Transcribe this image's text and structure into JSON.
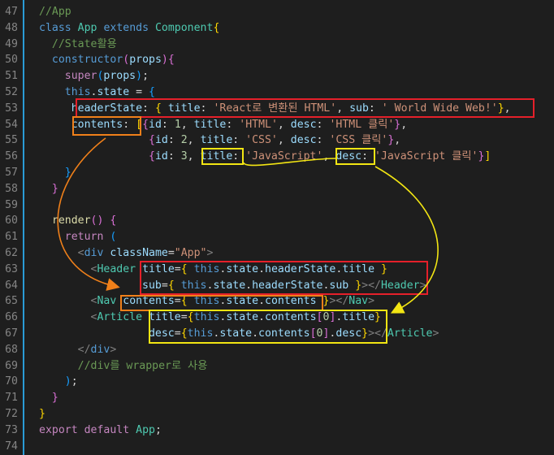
{
  "editor": {
    "lines": [
      {
        "num": "47",
        "tokens": [
          {
            "t": "//App",
            "c": "comment"
          }
        ]
      },
      {
        "num": "48",
        "tokens": [
          {
            "t": "class",
            "c": "kw"
          },
          {
            "t": " ",
            "c": "ident"
          },
          {
            "t": "App",
            "c": "cls"
          },
          {
            "t": " ",
            "c": "ident"
          },
          {
            "t": "extends",
            "c": "kw"
          },
          {
            "t": " ",
            "c": "ident"
          },
          {
            "t": "Component",
            "c": "cls"
          },
          {
            "t": "{",
            "c": "br1"
          }
        ]
      },
      {
        "num": "49",
        "tokens": [
          {
            "t": "  ",
            "c": "ident"
          },
          {
            "t": "//State활용",
            "c": "comment"
          }
        ]
      },
      {
        "num": "50",
        "tokens": [
          {
            "t": "  ",
            "c": "ident"
          },
          {
            "t": "constructor",
            "c": "kw"
          },
          {
            "t": "(",
            "c": "br2"
          },
          {
            "t": "props",
            "c": "var"
          },
          {
            "t": ")",
            "c": "br2"
          },
          {
            "t": "{",
            "c": "br2"
          }
        ]
      },
      {
        "num": "51",
        "tokens": [
          {
            "t": "    ",
            "c": "ident"
          },
          {
            "t": "super",
            "c": "ctrl"
          },
          {
            "t": "(",
            "c": "br3"
          },
          {
            "t": "props",
            "c": "var"
          },
          {
            "t": ")",
            "c": "br3"
          },
          {
            "t": ";",
            "c": "punc"
          }
        ]
      },
      {
        "num": "52",
        "tokens": [
          {
            "t": "    ",
            "c": "ident"
          },
          {
            "t": "this",
            "c": "kw"
          },
          {
            "t": ".",
            "c": "punc"
          },
          {
            "t": "state",
            "c": "var"
          },
          {
            "t": " = ",
            "c": "punc"
          },
          {
            "t": "{",
            "c": "br3"
          }
        ]
      },
      {
        "num": "53",
        "tokens": [
          {
            "t": "     ",
            "c": "ident"
          },
          {
            "t": "headerState",
            "c": "var"
          },
          {
            "t": ": ",
            "c": "punc"
          },
          {
            "t": "{",
            "c": "br1"
          },
          {
            "t": " ",
            "c": "ident"
          },
          {
            "t": "title",
            "c": "var"
          },
          {
            "t": ": ",
            "c": "punc"
          },
          {
            "t": "'React로 변환된 HTML'",
            "c": "str"
          },
          {
            "t": ", ",
            "c": "punc"
          },
          {
            "t": "sub",
            "c": "var"
          },
          {
            "t": ": ",
            "c": "punc"
          },
          {
            "t": "' World Wide Web!'",
            "c": "str"
          },
          {
            "t": "}",
            "c": "br1"
          },
          {
            "t": ",",
            "c": "punc"
          }
        ]
      },
      {
        "num": "54",
        "tokens": [
          {
            "t": "     ",
            "c": "ident"
          },
          {
            "t": "contents",
            "c": "var"
          },
          {
            "t": ": ",
            "c": "punc"
          },
          {
            "t": "[",
            "c": "br1"
          },
          {
            "t": "{",
            "c": "br2"
          },
          {
            "t": "id",
            "c": "var"
          },
          {
            "t": ": ",
            "c": "punc"
          },
          {
            "t": "1",
            "c": "num"
          },
          {
            "t": ", ",
            "c": "punc"
          },
          {
            "t": "title",
            "c": "var"
          },
          {
            "t": ": ",
            "c": "punc"
          },
          {
            "t": "'HTML'",
            "c": "str"
          },
          {
            "t": ", ",
            "c": "punc"
          },
          {
            "t": "desc",
            "c": "var"
          },
          {
            "t": ": ",
            "c": "punc"
          },
          {
            "t": "'HTML 클릭'",
            "c": "str"
          },
          {
            "t": "}",
            "c": "br2"
          },
          {
            "t": ",",
            "c": "punc"
          }
        ]
      },
      {
        "num": "55",
        "tokens": [
          {
            "t": "                 ",
            "c": "ident"
          },
          {
            "t": "{",
            "c": "br2"
          },
          {
            "t": "id",
            "c": "var"
          },
          {
            "t": ": ",
            "c": "punc"
          },
          {
            "t": "2",
            "c": "num"
          },
          {
            "t": ", ",
            "c": "punc"
          },
          {
            "t": "title",
            "c": "var"
          },
          {
            "t": ": ",
            "c": "punc"
          },
          {
            "t": "'CSS'",
            "c": "str"
          },
          {
            "t": ", ",
            "c": "punc"
          },
          {
            "t": "desc",
            "c": "var"
          },
          {
            "t": ": ",
            "c": "punc"
          },
          {
            "t": "'CSS 클릭'",
            "c": "str"
          },
          {
            "t": "}",
            "c": "br2"
          },
          {
            "t": ",",
            "c": "punc"
          }
        ]
      },
      {
        "num": "56",
        "tokens": [
          {
            "t": "                 ",
            "c": "ident"
          },
          {
            "t": "{",
            "c": "br2"
          },
          {
            "t": "id",
            "c": "var"
          },
          {
            "t": ": ",
            "c": "punc"
          },
          {
            "t": "3",
            "c": "num"
          },
          {
            "t": ", ",
            "c": "punc"
          },
          {
            "t": "title",
            "c": "var"
          },
          {
            "t": ": ",
            "c": "punc"
          },
          {
            "t": "'JavaScript'",
            "c": "str"
          },
          {
            "t": ", ",
            "c": "punc"
          },
          {
            "t": "desc",
            "c": "var"
          },
          {
            "t": ": ",
            "c": "punc"
          },
          {
            "t": "'JavaScript 클릭'",
            "c": "str"
          },
          {
            "t": "}",
            "c": "br2"
          },
          {
            "t": "]",
            "c": "br1"
          }
        ]
      },
      {
        "num": "57",
        "tokens": [
          {
            "t": "    ",
            "c": "ident"
          },
          {
            "t": "}",
            "c": "br3"
          }
        ]
      },
      {
        "num": "58",
        "tokens": [
          {
            "t": "  ",
            "c": "ident"
          },
          {
            "t": "}",
            "c": "br2"
          }
        ]
      },
      {
        "num": "59",
        "tokens": []
      },
      {
        "num": "60",
        "tokens": [
          {
            "t": "  ",
            "c": "ident"
          },
          {
            "t": "render",
            "c": "fn"
          },
          {
            "t": "()",
            "c": "br2"
          },
          {
            "t": " ",
            "c": "ident"
          },
          {
            "t": "{",
            "c": "br2"
          }
        ]
      },
      {
        "num": "61",
        "tokens": [
          {
            "t": "    ",
            "c": "ident"
          },
          {
            "t": "return",
            "c": "ctrl"
          },
          {
            "t": " ",
            "c": "ident"
          },
          {
            "t": "(",
            "c": "br3"
          }
        ]
      },
      {
        "num": "62",
        "tokens": [
          {
            "t": "      ",
            "c": "ident"
          },
          {
            "t": "<",
            "c": "brk"
          },
          {
            "t": "div",
            "c": "tag"
          },
          {
            "t": " ",
            "c": "ident"
          },
          {
            "t": "className",
            "c": "attr"
          },
          {
            "t": "=",
            "c": "punc"
          },
          {
            "t": "\"App\"",
            "c": "str"
          },
          {
            "t": ">",
            "c": "brk"
          }
        ]
      },
      {
        "num": "63",
        "tokens": [
          {
            "t": "        ",
            "c": "ident"
          },
          {
            "t": "<",
            "c": "brk"
          },
          {
            "t": "Header",
            "c": "tagcls"
          },
          {
            "t": " ",
            "c": "ident"
          },
          {
            "t": "title",
            "c": "attr"
          },
          {
            "t": "=",
            "c": "punc"
          },
          {
            "t": "{",
            "c": "br1"
          },
          {
            "t": " ",
            "c": "ident"
          },
          {
            "t": "this",
            "c": "kw"
          },
          {
            "t": ".",
            "c": "punc"
          },
          {
            "t": "state",
            "c": "var"
          },
          {
            "t": ".",
            "c": "punc"
          },
          {
            "t": "headerState",
            "c": "var"
          },
          {
            "t": ".",
            "c": "punc"
          },
          {
            "t": "title",
            "c": "var"
          },
          {
            "t": " ",
            "c": "ident"
          },
          {
            "t": "}",
            "c": "br1"
          }
        ]
      },
      {
        "num": "64",
        "tokens": [
          {
            "t": "                ",
            "c": "ident"
          },
          {
            "t": "sub",
            "c": "attr"
          },
          {
            "t": "=",
            "c": "punc"
          },
          {
            "t": "{",
            "c": "br1"
          },
          {
            "t": " ",
            "c": "ident"
          },
          {
            "t": "this",
            "c": "kw"
          },
          {
            "t": ".",
            "c": "punc"
          },
          {
            "t": "state",
            "c": "var"
          },
          {
            "t": ".",
            "c": "punc"
          },
          {
            "t": "headerState",
            "c": "var"
          },
          {
            "t": ".",
            "c": "punc"
          },
          {
            "t": "sub",
            "c": "var"
          },
          {
            "t": " ",
            "c": "ident"
          },
          {
            "t": "}",
            "c": "br1"
          },
          {
            "t": "></",
            "c": "brk"
          },
          {
            "t": "Header",
            "c": "tagcls"
          },
          {
            "t": ">",
            "c": "brk"
          }
        ]
      },
      {
        "num": "65",
        "tokens": [
          {
            "t": "        ",
            "c": "ident"
          },
          {
            "t": "<",
            "c": "brk"
          },
          {
            "t": "Nav",
            "c": "tagcls"
          },
          {
            "t": " ",
            "c": "ident"
          },
          {
            "t": "contents",
            "c": "attr"
          },
          {
            "t": "=",
            "c": "punc"
          },
          {
            "t": "{",
            "c": "br1"
          },
          {
            "t": " ",
            "c": "ident"
          },
          {
            "t": "this",
            "c": "kw"
          },
          {
            "t": ".",
            "c": "punc"
          },
          {
            "t": "state",
            "c": "var"
          },
          {
            "t": ".",
            "c": "punc"
          },
          {
            "t": "contents",
            "c": "var"
          },
          {
            "t": " ",
            "c": "ident"
          },
          {
            "t": "}",
            "c": "br1"
          },
          {
            "t": "></",
            "c": "brk"
          },
          {
            "t": "Nav",
            "c": "tagcls"
          },
          {
            "t": ">",
            "c": "brk"
          }
        ]
      },
      {
        "num": "66",
        "tokens": [
          {
            "t": "        ",
            "c": "ident"
          },
          {
            "t": "<",
            "c": "brk"
          },
          {
            "t": "Article",
            "c": "tagcls"
          },
          {
            "t": " ",
            "c": "ident"
          },
          {
            "t": "title",
            "c": "attr"
          },
          {
            "t": "=",
            "c": "punc"
          },
          {
            "t": "{",
            "c": "br1"
          },
          {
            "t": "this",
            "c": "kw"
          },
          {
            "t": ".",
            "c": "punc"
          },
          {
            "t": "state",
            "c": "var"
          },
          {
            "t": ".",
            "c": "punc"
          },
          {
            "t": "contents",
            "c": "var"
          },
          {
            "t": "[",
            "c": "br2"
          },
          {
            "t": "0",
            "c": "num"
          },
          {
            "t": "]",
            "c": "br2"
          },
          {
            "t": ".",
            "c": "punc"
          },
          {
            "t": "title",
            "c": "var"
          },
          {
            "t": "}",
            "c": "br1"
          }
        ]
      },
      {
        "num": "67",
        "tokens": [
          {
            "t": "                 ",
            "c": "ident"
          },
          {
            "t": "desc",
            "c": "attr"
          },
          {
            "t": "=",
            "c": "punc"
          },
          {
            "t": "{",
            "c": "br1"
          },
          {
            "t": "this",
            "c": "kw"
          },
          {
            "t": ".",
            "c": "punc"
          },
          {
            "t": "state",
            "c": "var"
          },
          {
            "t": ".",
            "c": "punc"
          },
          {
            "t": "contents",
            "c": "var"
          },
          {
            "t": "[",
            "c": "br2"
          },
          {
            "t": "0",
            "c": "num"
          },
          {
            "t": "]",
            "c": "br2"
          },
          {
            "t": ".",
            "c": "punc"
          },
          {
            "t": "desc",
            "c": "var"
          },
          {
            "t": "}",
            "c": "br1"
          },
          {
            "t": "></",
            "c": "brk"
          },
          {
            "t": "Article",
            "c": "tagcls"
          },
          {
            "t": ">",
            "c": "brk"
          }
        ]
      },
      {
        "num": "68",
        "tokens": [
          {
            "t": "      ",
            "c": "ident"
          },
          {
            "t": "</",
            "c": "brk"
          },
          {
            "t": "div",
            "c": "tag"
          },
          {
            "t": ">",
            "c": "brk"
          }
        ]
      },
      {
        "num": "69",
        "tokens": [
          {
            "t": "      ",
            "c": "ident"
          },
          {
            "t": "//div를 wrapper로 사용",
            "c": "comment"
          }
        ]
      },
      {
        "num": "70",
        "tokens": [
          {
            "t": "    ",
            "c": "ident"
          },
          {
            "t": ")",
            "c": "br3"
          },
          {
            "t": ";",
            "c": "punc"
          }
        ]
      },
      {
        "num": "71",
        "tokens": [
          {
            "t": "  ",
            "c": "ident"
          },
          {
            "t": "}",
            "c": "br2"
          }
        ]
      },
      {
        "num": "72",
        "tokens": [
          {
            "t": "}",
            "c": "br1"
          }
        ]
      },
      {
        "num": "73",
        "tokens": [
          {
            "t": "export",
            "c": "ctrl"
          },
          {
            "t": " ",
            "c": "ident"
          },
          {
            "t": "default",
            "c": "ctrl"
          },
          {
            "t": " ",
            "c": "ident"
          },
          {
            "t": "App",
            "c": "cls"
          },
          {
            "t": ";",
            "c": "punc"
          }
        ]
      },
      {
        "num": "74",
        "tokens": []
      }
    ]
  },
  "annotations": {
    "colors": {
      "red": "#e5202a",
      "orange": "#f0801a",
      "yellow": "#f2e513"
    }
  }
}
